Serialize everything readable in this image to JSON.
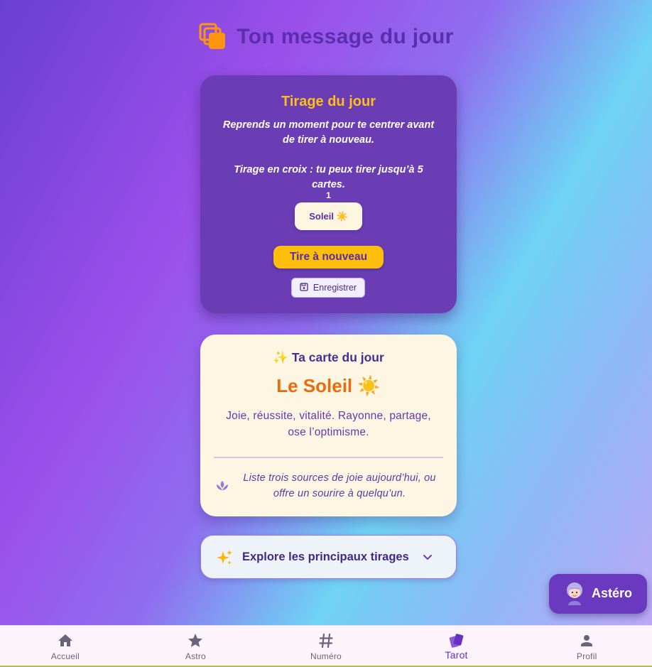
{
  "header": {
    "title": "Ton message du jour",
    "icon": "cards-stack-icon"
  },
  "tirage": {
    "title": "Tirage du jour",
    "instruction": "Reprends un moment pour te centrer avant de tirer à nouveau.",
    "info": "Tirage en croix : tu peux tirer jusqu’à 5 cartes.",
    "card_number": "1",
    "card_label": "Soleil ☀️",
    "redraw_label": "Tire à nouveau",
    "save_label": "Enregistrer"
  },
  "day_card": {
    "heading": "✨ Ta carte du jour",
    "name": "Le Soleil ☀️",
    "description": "Joie, réussite, vitalité. Rayonne, partage, ose l’optimisme.",
    "tip": "Liste trois sources de joie aujourd’hui, ou offre un sourire à quelqu’un."
  },
  "explore": {
    "label": "Explore les principaux tirages"
  },
  "assistant": {
    "label": "Astéro"
  },
  "nav": {
    "items": [
      {
        "label": "Accueil",
        "icon": "home-icon"
      },
      {
        "label": "Astro",
        "icon": "star-icon"
      },
      {
        "label": "Numéro",
        "icon": "hash-icon"
      },
      {
        "label": "Tarot",
        "icon": "tarot-cards-icon",
        "active": true
      },
      {
        "label": "Profil",
        "icon": "person-icon"
      }
    ]
  },
  "colors": {
    "accent_gold": "#ffbe0b",
    "purple_card": "#6a3db4",
    "title_purple": "#5a2fae",
    "sun_orange": "#ea6c0e",
    "cream": "#fcf6e3"
  }
}
